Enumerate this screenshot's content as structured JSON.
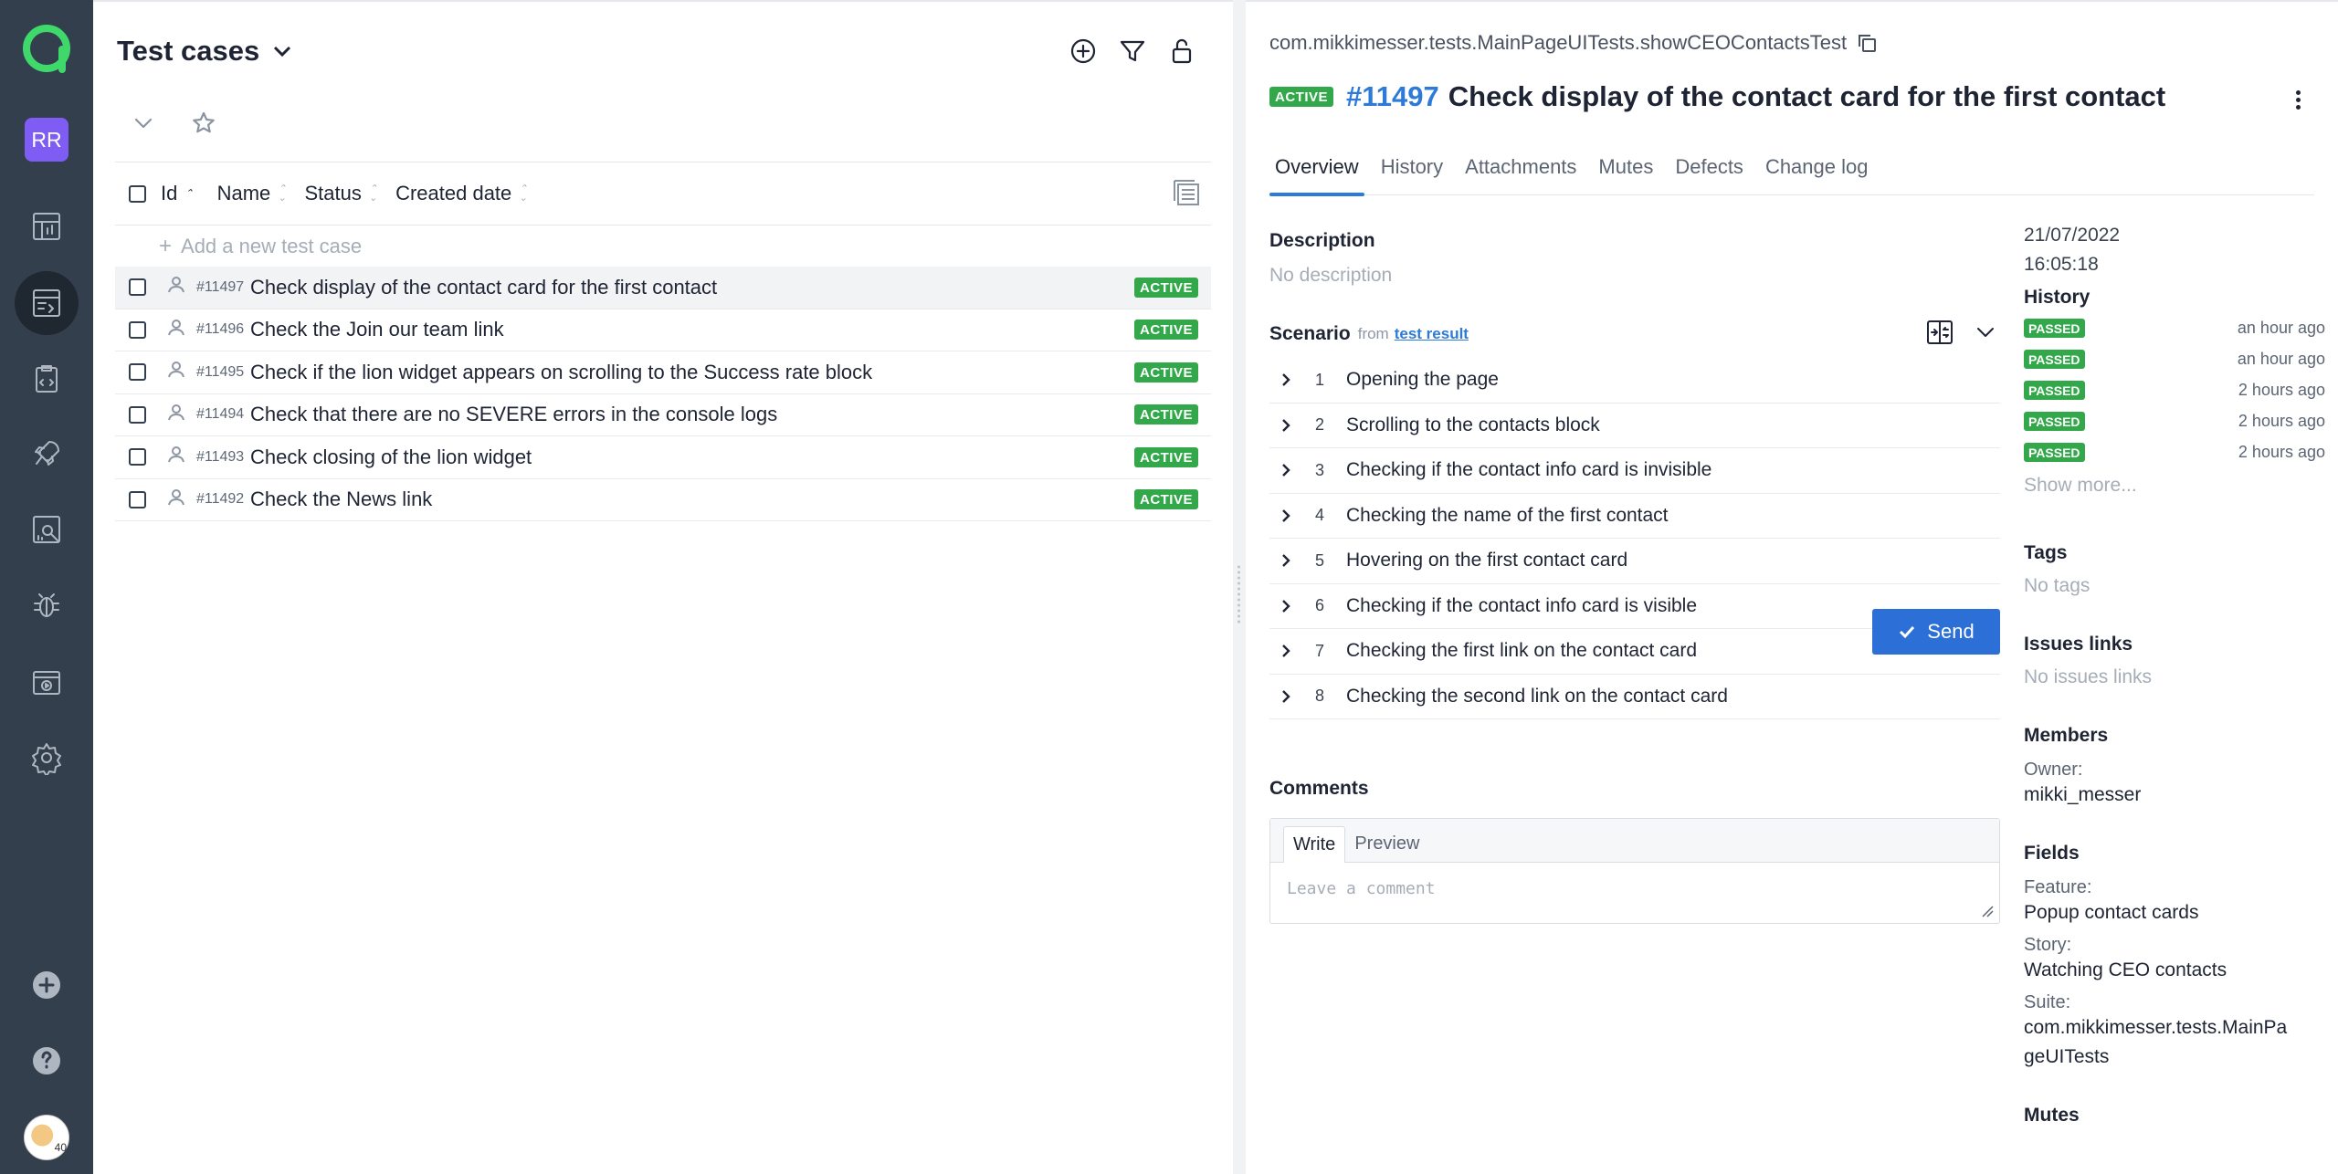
{
  "sidebar": {
    "user_initials": "RR",
    "avatar_text": "40",
    "icons": [
      "dashboard-icon",
      "test-cases-icon",
      "test-plans-icon",
      "launches-icon",
      "analytics-icon",
      "defects-icon",
      "jobs-icon",
      "settings-icon",
      "add-icon",
      "help-icon"
    ]
  },
  "left": {
    "title": "Test cases",
    "columns": [
      "Id",
      "Name",
      "Status",
      "Created date"
    ],
    "add_placeholder": "Add a new test case",
    "rows": [
      {
        "id": "#11497",
        "name": "Check display of the contact card for the first contact",
        "status": "ACTIVE"
      },
      {
        "id": "#11496",
        "name": "Check the Join our team link",
        "status": "ACTIVE"
      },
      {
        "id": "#11495",
        "name": "Check if the lion widget appears on scrolling to the Success rate block",
        "status": "ACTIVE"
      },
      {
        "id": "#11494",
        "name": "Check that there are no SEVERE errors in the console logs",
        "status": "ACTIVE"
      },
      {
        "id": "#11493",
        "name": "Check closing of the lion widget",
        "status": "ACTIVE"
      },
      {
        "id": "#11492",
        "name": "Check the News link",
        "status": "ACTIVE"
      }
    ]
  },
  "detail": {
    "full_path": "com.mikkimesser.tests.MainPageUITests.showCEOContactsTest",
    "status": "ACTIVE",
    "id": "#11497",
    "title": "Check display of the contact card for the first contact",
    "tabs": [
      "Overview",
      "History",
      "Attachments",
      "Mutes",
      "Defects",
      "Change log"
    ],
    "description_label": "Description",
    "description_value": "No description",
    "scenario_label": "Scenario",
    "scenario_from": "from",
    "scenario_link": "test result",
    "steps": [
      {
        "n": "1",
        "text": "Opening the page"
      },
      {
        "n": "2",
        "text": "Scrolling to the contacts block"
      },
      {
        "n": "3",
        "text": "Checking if the contact info card is invisible"
      },
      {
        "n": "4",
        "text": "Checking the name of the first contact"
      },
      {
        "n": "5",
        "text": "Hovering on the first contact card"
      },
      {
        "n": "6",
        "text": "Checking if the contact info card is visible"
      },
      {
        "n": "7",
        "text": "Checking the first link on the contact card"
      },
      {
        "n": "8",
        "text": "Checking the second link on the contact card"
      }
    ],
    "comments_label": "Comments",
    "comment_tab_write": "Write",
    "comment_tab_preview": "Preview",
    "comment_placeholder": "Leave a comment",
    "send_label": "Send"
  },
  "side": {
    "date": "21/07/2022",
    "time": "16:05:18",
    "history_label": "History",
    "history": [
      {
        "status": "PASSED",
        "time": "an hour ago"
      },
      {
        "status": "PASSED",
        "time": "an hour ago"
      },
      {
        "status": "PASSED",
        "time": "2 hours ago"
      },
      {
        "status": "PASSED",
        "time": "2 hours ago"
      },
      {
        "status": "PASSED",
        "time": "2 hours ago"
      }
    ],
    "show_more": "Show more...",
    "tags_label": "Tags",
    "tags_value": "No tags",
    "issues_label": "Issues links",
    "issues_value": "No issues links",
    "members_label": "Members",
    "owner_label": "Owner:",
    "owner_value": "mikki_messer",
    "fields_label": "Fields",
    "feature_label": "Feature:",
    "feature_value": "Popup contact cards",
    "story_label": "Story:",
    "story_value": "Watching CEO contacts",
    "suite_label": "Suite:",
    "suite_value_1": "com.mikkimesser.tests.MainPa",
    "suite_value_2": "geUITests",
    "mutes_label": "Mutes"
  },
  "colors": {
    "sidebar": "#343f4d",
    "accent": "#2e7ad8",
    "active_badge": "#33a84a",
    "brand": "#3fb950"
  }
}
